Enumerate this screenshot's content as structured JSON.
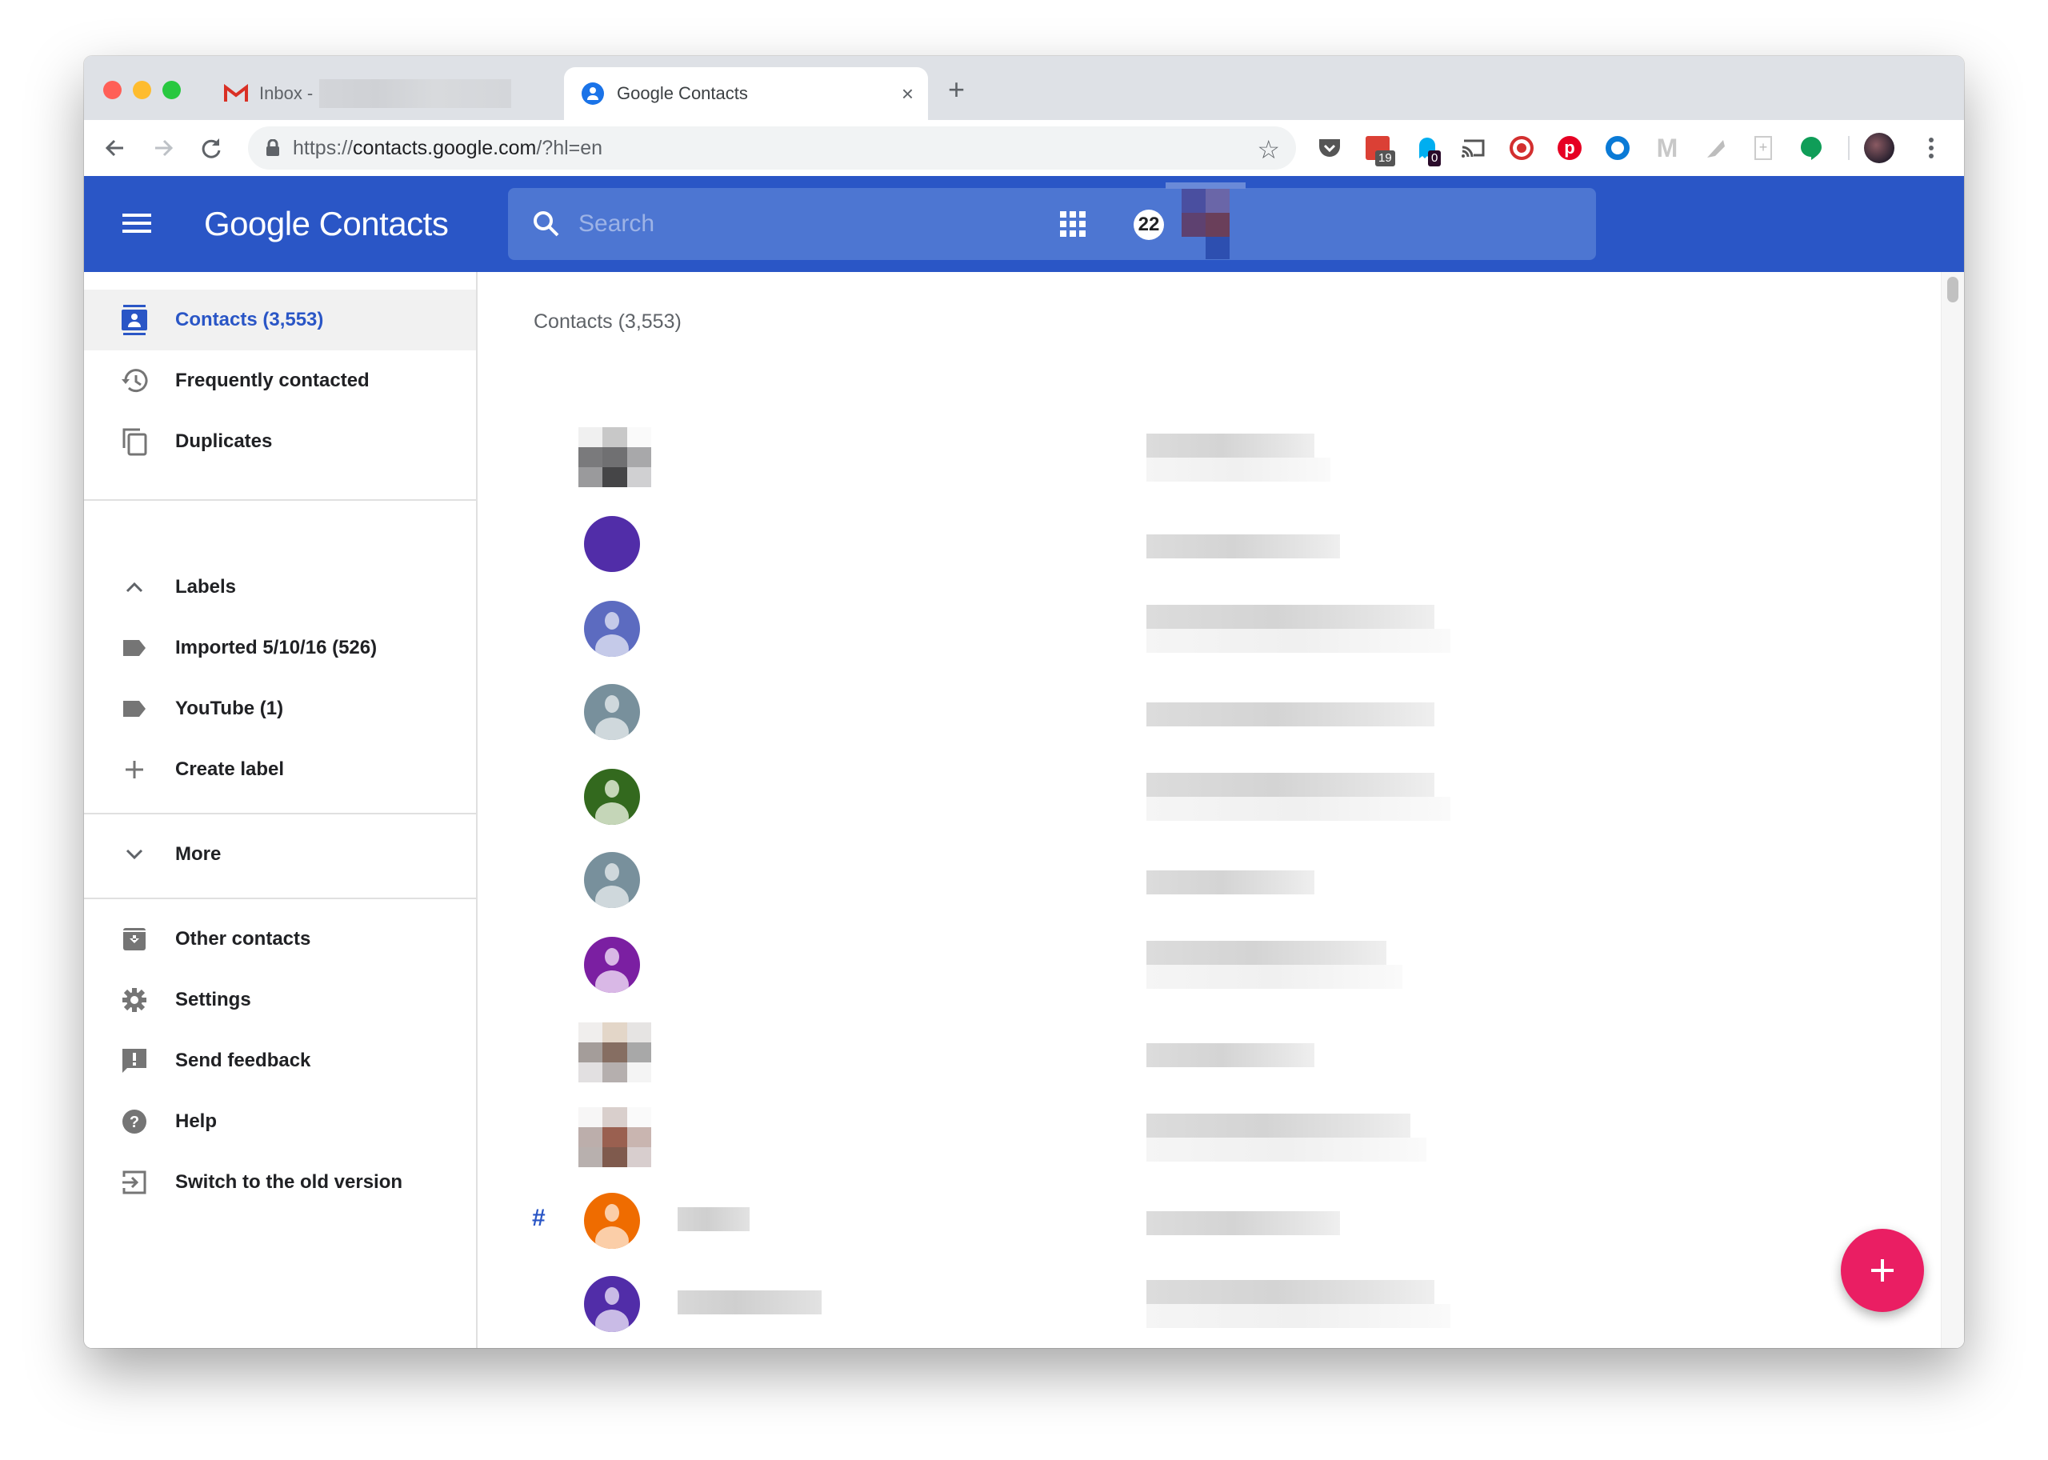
{
  "browser": {
    "tabs": [
      {
        "title": "Inbox -",
        "icon": "gmail-icon",
        "active": false
      },
      {
        "title": "Google Contacts",
        "icon": "contacts-icon",
        "active": true
      }
    ],
    "url_scheme": "https://",
    "url_host": "contacts.google.com",
    "url_path": "/?hl=en",
    "extensions": [
      {
        "name": "pocket-icon"
      },
      {
        "name": "todoist-icon",
        "badge": "19"
      },
      {
        "name": "ghostery-icon",
        "badge": "0"
      },
      {
        "name": "cast-icon"
      },
      {
        "name": "dog-extension-icon"
      },
      {
        "name": "pinterest-icon"
      },
      {
        "name": "ring-extension-icon"
      },
      {
        "name": "mixmax-icon"
      },
      {
        "name": "pen-extension-icon"
      },
      {
        "name": "document-add-icon"
      },
      {
        "name": "hangouts-icon"
      }
    ],
    "colors": {
      "tabstrip": "#dee1e6",
      "traffic_red": "#ff5f57",
      "traffic_yellow": "#febc2e",
      "traffic_green": "#28c840"
    }
  },
  "app": {
    "title": "Google Contacts",
    "search_placeholder": "Search",
    "notifications_count": "22",
    "accent": "#2a56c6",
    "fab_color": "#ea1e63"
  },
  "sidebar": {
    "items": [
      {
        "label": "Contacts (3,553)",
        "icon": "contacts-book-icon",
        "active": true
      },
      {
        "label": "Frequently contacted",
        "icon": "history-icon"
      },
      {
        "label": "Duplicates",
        "icon": "duplicate-icon"
      }
    ],
    "labels_header": "Labels",
    "labels": [
      {
        "label": "Imported 5/10/16 (526)",
        "icon": "label-icon"
      },
      {
        "label": "YouTube (1)",
        "icon": "label-icon"
      },
      {
        "label": "Create label",
        "icon": "plus-icon"
      }
    ],
    "more": "More",
    "bottom_items": [
      {
        "label": "Other contacts",
        "icon": "archive-icon"
      },
      {
        "label": "Settings",
        "icon": "gear-icon"
      },
      {
        "label": "Send feedback",
        "icon": "feedback-icon"
      },
      {
        "label": "Help",
        "icon": "help-icon"
      },
      {
        "label": "Switch to the old version",
        "icon": "exit-icon"
      }
    ]
  },
  "main": {
    "heading": "Contacts (3,553)",
    "section_letter": "#",
    "contacts": [
      {
        "avatar": "photo",
        "colors": [
          "#f0f0f0",
          "#c8c8c8",
          "#fafafa",
          "#7a7a7c",
          "#707072",
          "#a8a8aa",
          "#9a9a9c",
          "#454547",
          "#d0d0d2"
        ]
      },
      {
        "avatar": "solid",
        "color": "#512da8"
      },
      {
        "avatar": "person",
        "color": "#5c6bc0",
        "light": "#c5cae9"
      },
      {
        "avatar": "person",
        "color": "#78909c",
        "light": "#cfd8dc"
      },
      {
        "avatar": "person",
        "color": "#33691e",
        "light": "#c5d6b8"
      },
      {
        "avatar": "person",
        "color": "#78909c",
        "light": "#cfd8dc"
      },
      {
        "avatar": "person",
        "color": "#7b1fa2",
        "light": "#d9b8e6"
      },
      {
        "avatar": "photo",
        "colors": [
          "#f0eeed",
          "#e3d6c8",
          "#e6e4e3",
          "#a49d9a",
          "#866e62",
          "#a8a8a8",
          "#e2e0e1",
          "#b5afae",
          "#f4f4f4"
        ]
      },
      {
        "avatar": "photo",
        "colors": [
          "#f7f6f6",
          "#d9cfcc",
          "#fafafa",
          "#bcaeab",
          "#9a6050",
          "#c9b5b0",
          "#b8b0ae",
          "#7f5a4d",
          "#d8cece"
        ]
      },
      {
        "avatar": "person",
        "color": "#ef6c00",
        "light": "#fbcea8"
      },
      {
        "avatar": "person",
        "color": "#512da8",
        "light": "#c9bbe6"
      },
      {
        "avatar": "photo",
        "colors": [
          "#d4d4d4",
          "#a8a8a8",
          "#dadada",
          "#979797",
          "#8c8f94",
          "#a3a3a3",
          "#cfcfcf",
          "#c4c4c4",
          "#e0e0e0"
        ]
      }
    ]
  }
}
